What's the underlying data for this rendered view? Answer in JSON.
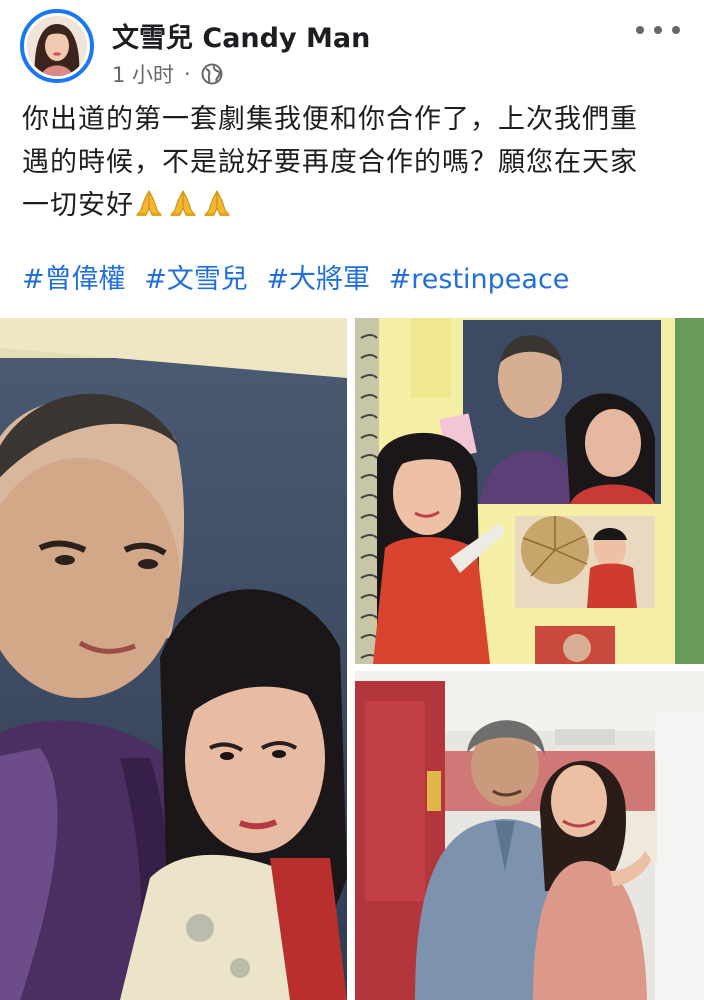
{
  "post": {
    "author": "文雪兒 Candy Man",
    "time": "1 小时",
    "separator": "·",
    "privacy_icon": "globe-icon",
    "more_icon": "more-dots-icon",
    "text_line1": "你出道的第一套劇集我便和你合作了，上次我們重",
    "text_line2": "遇的時候，不是說好要再度合作的嗎？願您在天家",
    "text_line3": "一切安好",
    "emoji": [
      "🙏",
      "🙏",
      "🙏"
    ],
    "hashtags": [
      "#曾偉權",
      "#文雪兒",
      "#大將軍",
      "#restinpeace"
    ]
  },
  "photos": {
    "photo1": "photo-vintage-couple",
    "photo2": "photo-scrapbook-page",
    "photo3": "photo-reunion-selfie"
  },
  "colors": {
    "accent": "#1877f2",
    "hashtag": "#216fdb",
    "meta": "#65676b"
  }
}
